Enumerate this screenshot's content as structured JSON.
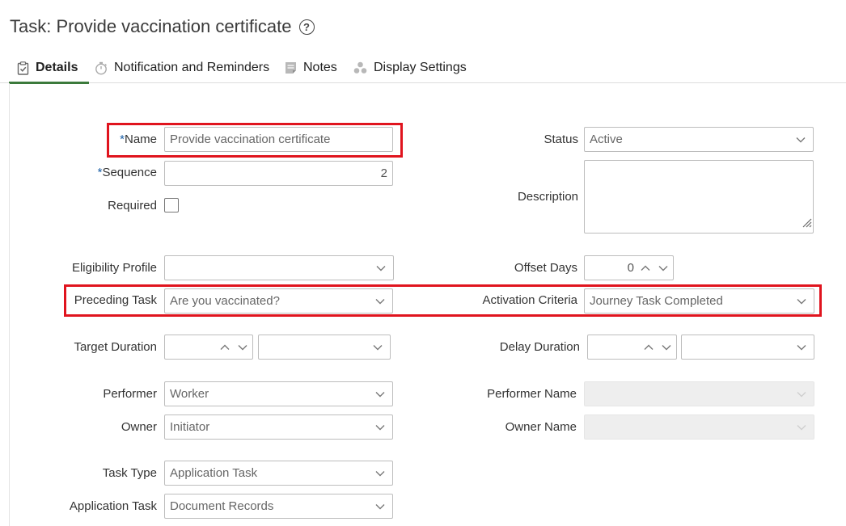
{
  "header": {
    "title": "Task: Provide vaccination certificate",
    "help_symbol": "?"
  },
  "tabs": [
    {
      "label": "Details",
      "icon": "clipboard-check-icon",
      "active": true
    },
    {
      "label": "Notification and Reminders",
      "icon": "stopwatch-icon",
      "active": false
    },
    {
      "label": "Notes",
      "icon": "note-icon",
      "active": false
    },
    {
      "label": "Display Settings",
      "icon": "dots-cluster-icon",
      "active": false
    }
  ],
  "form": {
    "required_marker": "*",
    "name": {
      "label": "Name",
      "value": "Provide vaccination certificate",
      "required": true
    },
    "sequence": {
      "label": "Sequence",
      "value": "2",
      "required": true
    },
    "required": {
      "label": "Required",
      "checked": false
    },
    "status": {
      "label": "Status",
      "value": "Active"
    },
    "description": {
      "label": "Description",
      "value": ""
    },
    "eligibility_profile": {
      "label": "Eligibility Profile",
      "value": ""
    },
    "offset_days": {
      "label": "Offset Days",
      "value": "0"
    },
    "preceding_task": {
      "label": "Preceding Task",
      "value": "Are you vaccinated?"
    },
    "activation_criteria": {
      "label": "Activation Criteria",
      "value": "Journey Task Completed"
    },
    "target_duration": {
      "label": "Target Duration",
      "value": "",
      "unit": ""
    },
    "delay_duration": {
      "label": "Delay Duration",
      "value": "",
      "unit": ""
    },
    "performer": {
      "label": "Performer",
      "value": "Worker"
    },
    "performer_name": {
      "label": "Performer Name",
      "value": ""
    },
    "owner": {
      "label": "Owner",
      "value": "Initiator"
    },
    "owner_name": {
      "label": "Owner Name",
      "value": ""
    },
    "task_type": {
      "label": "Task Type",
      "value": "Application Task"
    },
    "application_task": {
      "label": "Application Task",
      "value": "Document Records"
    }
  },
  "colors": {
    "highlight": "#e0141e",
    "active_tab_underline": "#3c7a3c",
    "required_marker": "#1b5fa6"
  }
}
